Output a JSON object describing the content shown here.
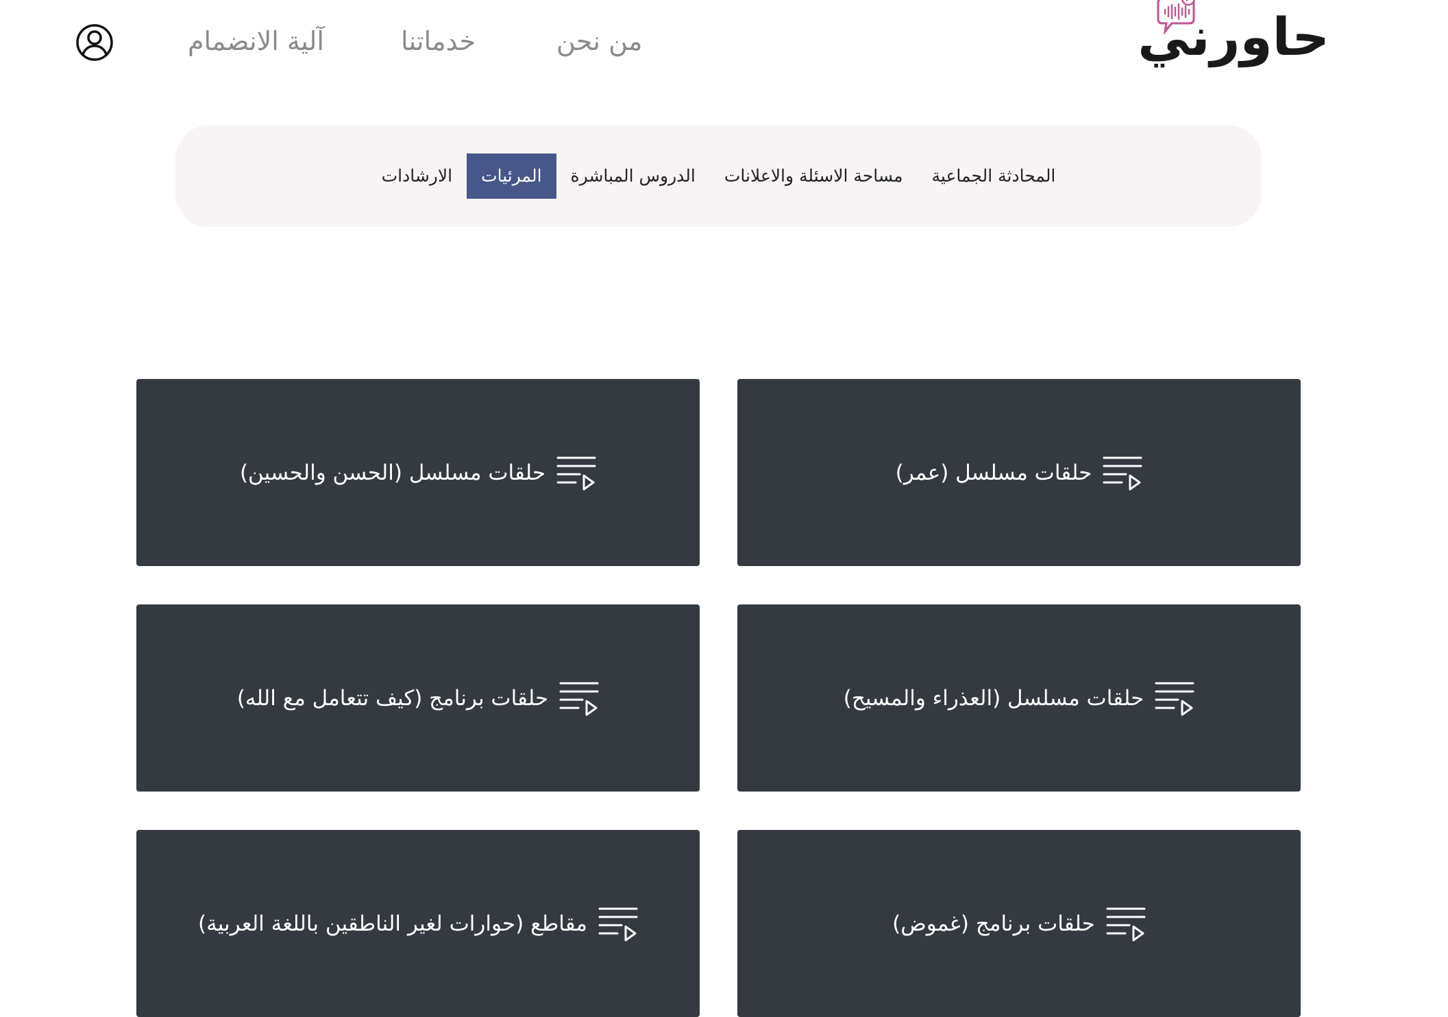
{
  "header": {
    "logo_text": "حاورني",
    "nav": [
      {
        "label": "من نحن"
      },
      {
        "label": "خدماتنا"
      },
      {
        "label": "آلية الانضمام"
      }
    ]
  },
  "tabs": [
    {
      "label": "المحادثة الجماعية",
      "active": false
    },
    {
      "label": "مساحة الاسئلة والاعلانات",
      "active": false
    },
    {
      "label": "الدروس المباشرة",
      "active": false
    },
    {
      "label": "المرئيات",
      "active": true
    },
    {
      "label": "الارشادات",
      "active": false
    }
  ],
  "cards": [
    {
      "title": "حلقات مسلسل (عمر)",
      "icon": "playlist-play-icon"
    },
    {
      "title": "حلقات مسلسل (الحسن والحسين)",
      "icon": "playlist-play-icon"
    },
    {
      "title": "حلقات مسلسل (العذراء والمسيح)",
      "icon": "playlist-play-icon"
    },
    {
      "title": "حلقات برنامج (كيف تتعامل مع الله)",
      "icon": "playlist-play-icon"
    },
    {
      "title": "حلقات برنامج (غموض)",
      "icon": "playlist-play-icon"
    },
    {
      "title": "مقاطع (حوارات لغير الناطقين باللغة العربية)",
      "icon": "playlist-play-icon"
    }
  ],
  "colors": {
    "accent": "#48578a",
    "card_bg": "#343a40",
    "tabs_bg": "#f8f4f5",
    "logo_pink": "#c2538f"
  }
}
